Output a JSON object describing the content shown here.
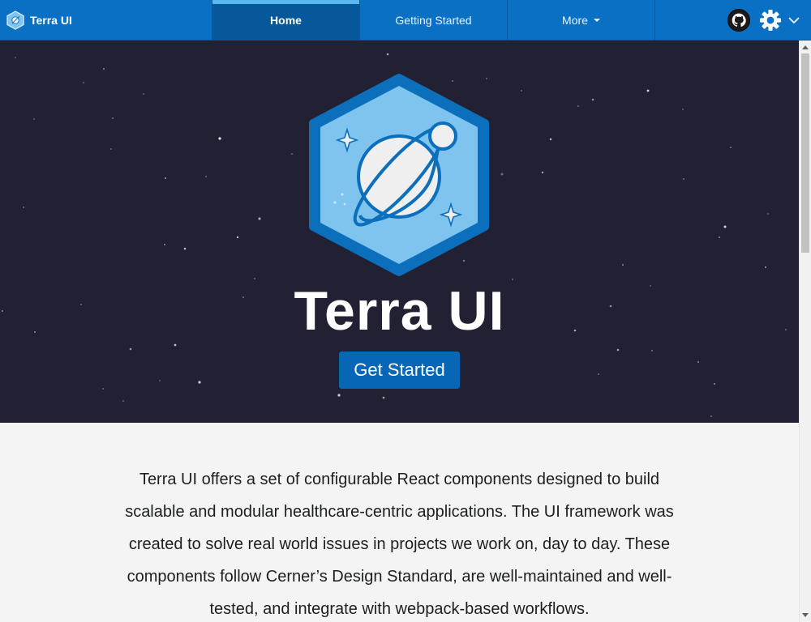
{
  "brand": {
    "name": "Terra UI"
  },
  "nav": {
    "tabs": [
      {
        "label": "Home",
        "active": true
      },
      {
        "label": "Getting Started",
        "active": false
      },
      {
        "label": "More",
        "active": false,
        "has_menu": true
      }
    ],
    "icons": {
      "github": "github-icon",
      "settings": "gear-icon",
      "settings_menu": "chevron-down-icon"
    }
  },
  "hero": {
    "title": "Terra UI",
    "cta_label": "Get Started",
    "logo": "terra-planet-hexagon-logo"
  },
  "intro": {
    "text": "Terra UI offers a set of configurable React components designed to build scalable and modular healthcare-centric applications. The UI framework was created to solve real world issues in projects we work on, day to day. These components follow Cerner’s Design Standard, are well-maintained and well-tested, and integrate with webpack-based workflows."
  },
  "colors": {
    "nav_background": "#0a70c3",
    "nav_active_tab": "#07589a",
    "nav_active_indicator": "#5bb8ee",
    "hero_background": "#212133",
    "cta_background": "#0766b5",
    "logo_light": "#7ec4ee",
    "logo_dark": "#0b6fbc",
    "page_background": "#f4f4f4"
  }
}
